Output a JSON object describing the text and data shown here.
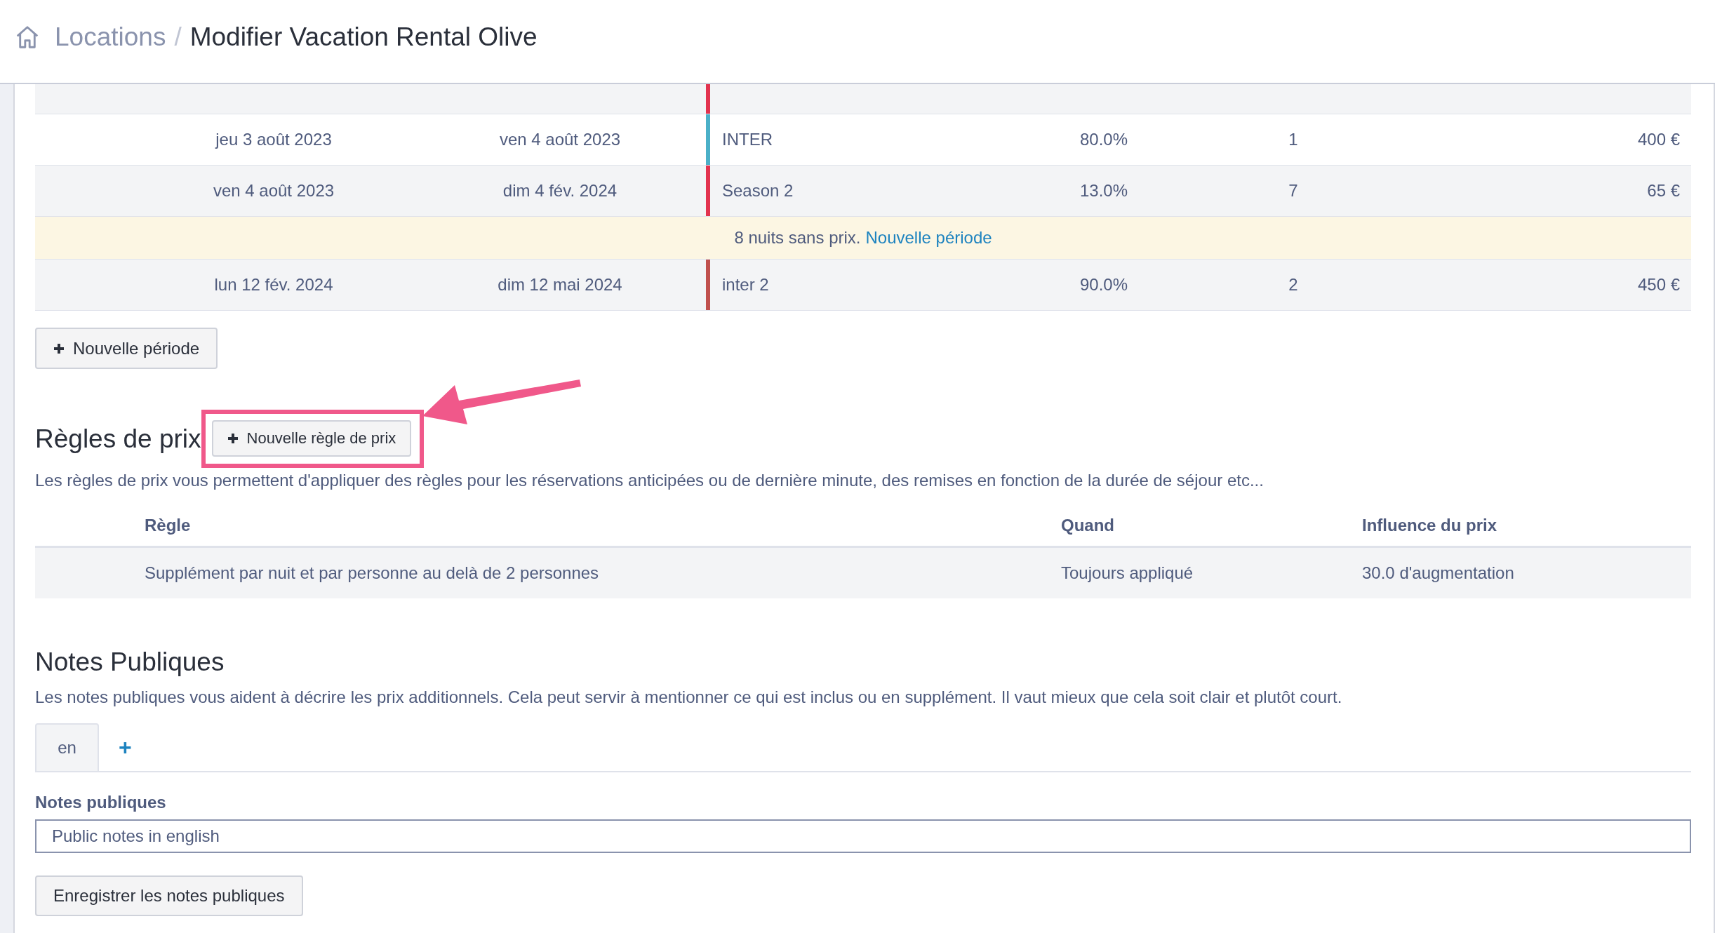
{
  "breadcrumb": {
    "parent": "Locations",
    "separator": "/",
    "current": "Modifier Vacation Rental Olive"
  },
  "periods": [
    {
      "kind": "clipped",
      "color": "#e2334f"
    },
    {
      "kind": "period",
      "start": "jeu 3 août 2023",
      "end": "ven 4 août 2023",
      "name": "INTER",
      "color": "#4bb0c8",
      "percent": "80.0%",
      "min_nights": "1",
      "price": "400 €"
    },
    {
      "kind": "period",
      "start": "ven 4 août 2023",
      "end": "dim 4 fév. 2024",
      "name": "Season 2",
      "color": "#e2334f",
      "percent": "13.0%",
      "min_nights": "7",
      "price": "65 €"
    },
    {
      "kind": "gap",
      "text": "8 nuits sans prix.",
      "link": "Nouvelle période"
    },
    {
      "kind": "period",
      "start": "lun 12 fév. 2024",
      "end": "dim 12 mai 2024",
      "name": "inter 2",
      "color": "#c0504d",
      "percent": "90.0%",
      "min_nights": "2",
      "price": "450 €"
    }
  ],
  "add_period_button": "Nouvelle période",
  "price_rules": {
    "title": "Règles de prix",
    "add_button": "Nouvelle règle de prix",
    "description": "Les règles de prix vous permettent d'appliquer des règles pour les réservations anticipées ou de dernière minute, des remises en fonction de la durée de séjour etc...",
    "columns": [
      "Règle",
      "Quand",
      "Influence du prix"
    ],
    "rows": [
      [
        "Supplément par nuit et par personne au delà de 2 personnes",
        "Toujours appliqué",
        "30.0 d'augmentation"
      ]
    ]
  },
  "public_notes": {
    "title": "Notes Publiques",
    "description": "Les notes publiques vous aident à décrire les prix additionnels. Cela peut servir à mentionner ce qui est inclus ou en supplément. Il vaut mieux que cela soit clair et plutôt court.",
    "tabs": [
      {
        "label": "en",
        "selected": true
      }
    ],
    "add_tab": "+",
    "field_label": "Notes publiques",
    "value": "Public notes in english",
    "save_button": "Enregistrer les notes publiques"
  }
}
